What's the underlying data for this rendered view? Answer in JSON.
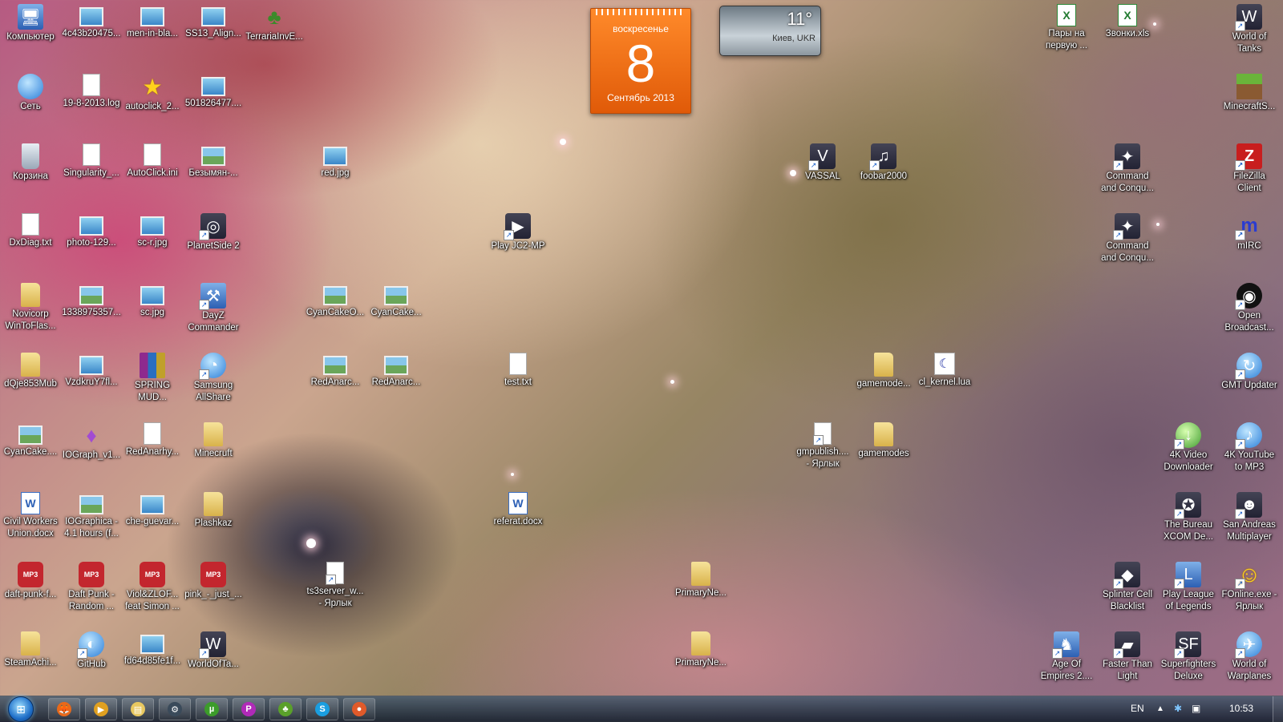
{
  "desktop": {
    "icons": [
      {
        "label": "Компьютер",
        "icon": "computer-icon",
        "type": "t-sys",
        "glyph": "🖥",
        "shortcut": false
      },
      {
        "label": "4c43b20475...",
        "icon": "image-file-icon",
        "type": "t-image",
        "glyph": "",
        "shortcut": false
      },
      {
        "label": "men-in-bla...",
        "icon": "image-file-icon",
        "type": "t-image",
        "glyph": "",
        "shortcut": false
      },
      {
        "label": "SS13_Align...",
        "icon": "image-file-icon",
        "type": "t-image",
        "glyph": "",
        "shortcut": false
      },
      {
        "label": "TerrariaInvE...",
        "icon": "tree-icon",
        "type": "t-tree",
        "glyph": "♣",
        "shortcut": false
      },
      {
        "label": "Сеть",
        "icon": "network-icon",
        "type": "t-blue",
        "glyph": "",
        "shortcut": false
      },
      {
        "label": "19-8-2013.log",
        "icon": "text-file-icon",
        "type": "t-doc",
        "glyph": "",
        "shortcut": false
      },
      {
        "label": "autoclick_2...",
        "icon": "star-icon",
        "type": "t-star",
        "glyph": "★",
        "shortcut": false
      },
      {
        "label": "501826477....",
        "icon": "image-file-icon",
        "type": "t-image",
        "glyph": "",
        "shortcut": false
      },
      {
        "label": "Корзина",
        "icon": "recycle-bin-icon",
        "type": "t-bin",
        "glyph": "",
        "shortcut": false
      },
      {
        "label": "Singularity_...",
        "icon": "text-file-icon",
        "type": "t-doc",
        "glyph": "",
        "shortcut": false
      },
      {
        "label": "AutoClick.ini",
        "icon": "settings-file-icon",
        "type": "t-doc",
        "glyph": "⚙",
        "shortcut": false
      },
      {
        "label": "Безымян-...",
        "icon": "image-file-icon",
        "type": "t-photo",
        "glyph": "",
        "shortcut": false
      },
      {
        "label": "red.jpg",
        "icon": "image-file-icon",
        "type": "t-image",
        "glyph": "",
        "shortcut": false
      },
      {
        "label": "VASSAL",
        "icon": "vassal-icon",
        "type": "t-game",
        "glyph": "V",
        "shortcut": true
      },
      {
        "label": "foobar2000",
        "icon": "foobar-icon",
        "type": "t-game",
        "glyph": "♫",
        "shortcut": true
      },
      {
        "label": "Command\nand Conqu...",
        "icon": "command-conquer-icon",
        "type": "t-game",
        "glyph": "✦",
        "shortcut": true
      },
      {
        "label": "FileZilla\nClient",
        "icon": "filezilla-icon",
        "type": "t-fz",
        "glyph": "Z",
        "shortcut": true
      },
      {
        "label": "DxDiag.txt",
        "icon": "text-file-icon",
        "type": "t-doc",
        "glyph": "",
        "shortcut": false
      },
      {
        "label": "photo-129...",
        "icon": "image-file-icon",
        "type": "t-image",
        "glyph": "",
        "shortcut": false
      },
      {
        "label": "sc-r.jpg",
        "icon": "image-file-icon",
        "type": "t-image",
        "glyph": "",
        "shortcut": false
      },
      {
        "label": "PlanetSide 2",
        "icon": "planetside-icon",
        "type": "t-game",
        "glyph": "◎",
        "shortcut": true
      },
      {
        "label": "Play JC2-MP",
        "icon": "jc2mp-icon",
        "type": "t-game",
        "glyph": "▶",
        "shortcut": true
      },
      {
        "label": "Command\nand Conqu...",
        "icon": "command-conquer-icon",
        "type": "t-game",
        "glyph": "✦",
        "shortcut": true
      },
      {
        "label": "mIRC",
        "icon": "mirc-icon",
        "type": "t-mirc",
        "glyph": "m",
        "shortcut": true
      },
      {
        "label": "Novicorp\nWinToFlas...",
        "icon": "folder-icon",
        "type": "t-folder",
        "glyph": "",
        "shortcut": false
      },
      {
        "label": "1338975357...",
        "icon": "image-file-icon",
        "type": "t-photo",
        "glyph": "",
        "shortcut": false
      },
      {
        "label": "sc.jpg",
        "icon": "image-file-icon",
        "type": "t-image",
        "glyph": "",
        "shortcut": false
      },
      {
        "label": "DayZ\nCommander",
        "icon": "dayz-commander-icon",
        "type": "t-sys",
        "glyph": "⚒",
        "shortcut": true
      },
      {
        "label": "CyanCakeO...",
        "icon": "image-file-icon",
        "type": "t-photo",
        "glyph": "",
        "shortcut": false
      },
      {
        "label": "CyanCake...",
        "icon": "image-file-icon",
        "type": "t-photo",
        "glyph": "",
        "shortcut": false
      },
      {
        "label": "Open\nBroadcast...",
        "icon": "obs-icon",
        "type": "t-obs",
        "glyph": "◉",
        "shortcut": true
      },
      {
        "label": "dQje853Mub",
        "icon": "folder-icon",
        "type": "t-folder",
        "glyph": "",
        "shortcut": false
      },
      {
        "label": "VzdkruY7fl...",
        "icon": "image-file-icon",
        "type": "t-image",
        "glyph": "",
        "shortcut": false
      },
      {
        "label": "SPRING\nMUD...",
        "icon": "winrar-icon",
        "type": "t-rar",
        "glyph": "",
        "shortcut": false
      },
      {
        "label": "Samsung\nAllShare",
        "icon": "samsung-allshare-icon",
        "type": "t-blue",
        "glyph": "◔",
        "shortcut": true
      },
      {
        "label": "RedAnarc...",
        "icon": "image-file-icon",
        "type": "t-photo",
        "glyph": "",
        "shortcut": false
      },
      {
        "label": "RedAnarc...",
        "icon": "image-file-icon",
        "type": "t-photo",
        "glyph": "",
        "shortcut": false
      },
      {
        "label": "test.txt",
        "icon": "text-file-icon",
        "type": "t-doc",
        "glyph": "",
        "shortcut": false
      },
      {
        "label": "gamemode...",
        "icon": "folder-icon",
        "type": "t-folder",
        "glyph": "",
        "shortcut": false
      },
      {
        "label": "cl_kernel.lua",
        "icon": "lua-file-icon",
        "type": "t-lua",
        "glyph": "☾",
        "shortcut": false
      },
      {
        "label": "GMT Updater",
        "icon": "gmt-updater-icon",
        "type": "t-blue",
        "glyph": "↻",
        "shortcut": true
      },
      {
        "label": "CyanCake....",
        "icon": "image-file-icon",
        "type": "t-photo",
        "glyph": "",
        "shortcut": false
      },
      {
        "label": "IOGraph_v1...",
        "icon": "iograph-icon",
        "type": "t-purple",
        "glyph": "♦",
        "shortcut": false
      },
      {
        "label": "RedAnarhy...",
        "icon": "psd-file-icon",
        "type": "t-doc",
        "glyph": "",
        "shortcut": false
      },
      {
        "label": "Minecruft",
        "icon": "folder-icon",
        "type": "t-folder",
        "glyph": "",
        "shortcut": false
      },
      {
        "label": "gmpublish....\n- Ярлык",
        "icon": "application-shortcut-icon",
        "type": "t-doc",
        "glyph": "",
        "shortcut": true
      },
      {
        "label": "gamemodes",
        "icon": "folder-icon",
        "type": "t-folder",
        "glyph": "",
        "shortcut": false
      },
      {
        "label": "4K Video\nDownloader",
        "icon": "4k-video-downloader-icon",
        "type": "t-green",
        "glyph": "↓",
        "shortcut": true
      },
      {
        "label": "4K YouTube\nto MP3",
        "icon": "4k-youtube-mp3-icon",
        "type": "t-blue",
        "glyph": "♪",
        "shortcut": true
      },
      {
        "label": "Civil Workers\nUnion.docx",
        "icon": "word-document-icon",
        "type": "t-word",
        "glyph": "W",
        "shortcut": false
      },
      {
        "label": "IOGraphica -\n4.1 hours (f...",
        "icon": "image-file-icon",
        "type": "t-photo",
        "glyph": "",
        "shortcut": false
      },
      {
        "label": "che-guevar...",
        "icon": "image-file-icon",
        "type": "t-image",
        "glyph": "",
        "shortcut": false
      },
      {
        "label": "Plashkaz",
        "icon": "folder-icon",
        "type": "t-folder",
        "glyph": "",
        "shortcut": false
      },
      {
        "label": "referat.docx",
        "icon": "word-document-icon",
        "type": "t-word",
        "glyph": "W",
        "shortcut": false
      },
      {
        "label": "The Bureau\nXCOM De...",
        "icon": "xcom-icon",
        "type": "t-game",
        "glyph": "✪",
        "shortcut": true
      },
      {
        "label": "San Andreas\nMultiplayer",
        "icon": "samp-icon",
        "type": "t-game",
        "glyph": "☻",
        "shortcut": true
      },
      {
        "label": "daft-punk-f...",
        "icon": "mp3-file-icon",
        "type": "t-mp3",
        "glyph": "MP3",
        "shortcut": false
      },
      {
        "label": "Daft Punk -\nRandom ...",
        "icon": "mp3-file-icon",
        "type": "t-mp3",
        "glyph": "MP3",
        "shortcut": false
      },
      {
        "label": "Viol&ZLOF...\nfeat Simon ...",
        "icon": "mp3-file-icon",
        "type": "t-mp3",
        "glyph": "MP3",
        "shortcut": false
      },
      {
        "label": "pink_-_just_...",
        "icon": "mp3-file-icon",
        "type": "t-mp3",
        "glyph": "MP3",
        "shortcut": false
      },
      {
        "label": "ts3server_w...\n- Ярлык",
        "icon": "application-shortcut-icon",
        "type": "t-doc",
        "glyph": "",
        "shortcut": true
      },
      {
        "label": "PrimaryNe...",
        "icon": "folder-icon",
        "type": "t-folder",
        "glyph": "",
        "shortcut": false
      },
      {
        "label": "Splinter Cell\nBlacklist",
        "icon": "splinter-cell-icon",
        "type": "t-game",
        "glyph": "◆",
        "shortcut": true
      },
      {
        "label": "Play League\nof Legends",
        "icon": "league-of-legends-icon",
        "type": "t-sys",
        "glyph": "L",
        "shortcut": true
      },
      {
        "label": "FOnline.exe -\nЯрлык",
        "icon": "fonline-icon",
        "type": "t-star",
        "glyph": "☺",
        "shortcut": true
      },
      {
        "label": "SteamAchi...",
        "icon": "folder-icon",
        "type": "t-folder",
        "glyph": "",
        "shortcut": false
      },
      {
        "label": "GitHub",
        "icon": "github-icon",
        "type": "t-blue",
        "glyph": "◐",
        "shortcut": true
      },
      {
        "label": "fd64d85fe1f...",
        "icon": "image-file-icon",
        "type": "t-image",
        "glyph": "",
        "shortcut": false
      },
      {
        "label": "WorldOfTa...",
        "icon": "world-of-tanks-icon",
        "type": "t-game",
        "glyph": "W",
        "shortcut": true
      },
      {
        "label": "PrimaryNe...",
        "icon": "folder-icon",
        "type": "t-folder",
        "glyph": "",
        "shortcut": false
      },
      {
        "label": "Age Of\nEmpires 2....",
        "icon": "age-of-empires-icon",
        "type": "t-sys",
        "glyph": "♞",
        "shortcut": true
      },
      {
        "label": "Faster Than\nLight",
        "icon": "ftl-icon",
        "type": "t-game",
        "glyph": "▰",
        "shortcut": true
      },
      {
        "label": "Superfighters\nDeluxe",
        "icon": "superfighters-icon",
        "type": "t-game",
        "glyph": "SF",
        "shortcut": true
      },
      {
        "label": "World of\nWarplanes",
        "icon": "world-of-warplanes-icon",
        "type": "t-blue",
        "glyph": "✈",
        "shortcut": true
      },
      {
        "label": "Пары на\nпервую ...",
        "icon": "excel-file-icon",
        "type": "t-excel",
        "glyph": "X",
        "shortcut": false
      },
      {
        "label": "Звонки.xls",
        "icon": "excel-file-icon",
        "type": "t-excel",
        "glyph": "X",
        "shortcut": false
      },
      {
        "label": "World of\nTanks",
        "icon": "world-of-tanks-icon",
        "type": "t-game",
        "glyph": "W",
        "shortcut": true
      },
      {
        "label": "MinecraftS...",
        "icon": "minecraft-icon",
        "type": "t-mc",
        "glyph": "",
        "shortcut": false
      }
    ]
  },
  "gadgets": {
    "calendar": {
      "weekday": "воскресенье",
      "day": "8",
      "month_year": "Сентябрь 2013"
    },
    "weather": {
      "temperature": "11°",
      "location": "Киев, UKR"
    }
  },
  "taskbar": {
    "start_icon": "windows-start-icon",
    "buttons": [
      {
        "icon": "firefox-icon",
        "glyph": "🦊",
        "color": "#e8691a"
      },
      {
        "icon": "media-player-icon",
        "glyph": "▶",
        "color": "#e0a020"
      },
      {
        "icon": "explorer-icon",
        "glyph": "▤",
        "color": "#e8c860"
      },
      {
        "icon": "steam-icon",
        "glyph": "⚙",
        "color": "#3a4a5a"
      },
      {
        "icon": "utorrent-icon",
        "glyph": "µ",
        "color": "#3c9c2a"
      },
      {
        "icon": "picpick-icon",
        "glyph": "P",
        "color": "#b02ab8"
      },
      {
        "icon": "game-launcher-icon",
        "glyph": "♣",
        "color": "#5aa02a"
      },
      {
        "icon": "skype-icon",
        "glyph": "S",
        "color": "#1a9ee0"
      },
      {
        "icon": "screen-recorder-icon",
        "glyph": "●",
        "color": "#e05a2a"
      }
    ],
    "language": "EN",
    "clock": "10:53"
  },
  "colors": {
    "calendar_orange": "#f07018",
    "taskbar": "#2a3a4c"
  }
}
